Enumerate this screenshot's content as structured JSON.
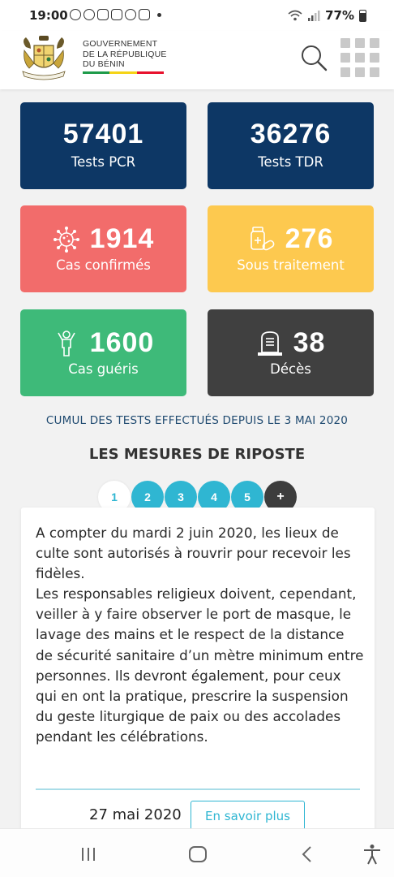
{
  "status_bar": {
    "time": "19:00",
    "battery": "77%"
  },
  "header": {
    "gov_lines": [
      "GOUVERNEMENT",
      "DE LA RÉPUBLIQUE",
      "DU BÉNIN"
    ],
    "flag_colors": [
      "#1e9b4a",
      "#f5d316",
      "#e8112d"
    ],
    "search_icon": "search-icon",
    "menu_icon": "grid-menu-icon"
  },
  "stats": {
    "pcr": {
      "value": "57401",
      "label": "Tests PCR",
      "color": "#0d3765"
    },
    "tdr": {
      "value": "36276",
      "label": "Tests TDR",
      "color": "#0d3765"
    },
    "confirmed": {
      "value": "1914",
      "label": "Cas confirmés",
      "color": "#f26c6b",
      "icon": "virus-icon"
    },
    "treatment": {
      "value": "276",
      "label": "Sous traitement",
      "color": "#fdc94f",
      "icon": "medicine-icon"
    },
    "recovered": {
      "value": "1600",
      "label": "Cas guéris",
      "color": "#3eba79",
      "icon": "person-icon"
    },
    "deaths": {
      "value": "38",
      "label": "Décès",
      "color": "#404040",
      "icon": "tombstone-icon"
    }
  },
  "cumul_note": "CUMUL DES TESTS EFFECTUÉS DEPUIS LE 3 MAI 2020",
  "section_title": "LES MESURES DE RIPOSTE",
  "pager": {
    "pages": [
      "1",
      "2",
      "3",
      "4",
      "5"
    ],
    "active": "1",
    "more": "+"
  },
  "article": {
    "paragraphs": [
      "A compter du mardi 2 juin 2020, les lieux de culte sont autorisés à rouvrir pour recevoir les fidèles.",
      "Les responsables religieux doivent, cependant, veiller à y faire observer le port de masque, le lavage des mains et le respect de la distance de sécurité sanitaire d’un mètre minimum entre personnes. Ils devront également, pour ceux qui en ont la pratique, prescrire la suspension du geste liturgique de paix ou des accolades pendant les célébrations."
    ],
    "date": "27 mai 2020",
    "more_label": "En savoir plus"
  }
}
